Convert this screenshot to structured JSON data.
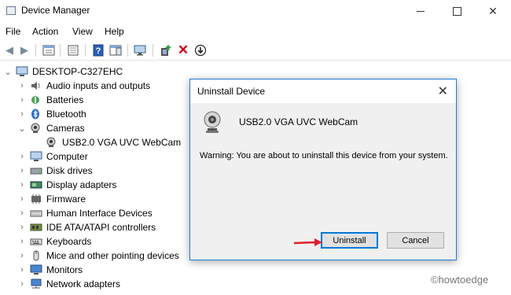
{
  "window": {
    "title": "Device Manager"
  },
  "menu": [
    "File",
    "Action",
    "View",
    "Help"
  ],
  "colors": {
    "accent": "#0078d7",
    "arrow": "#e01f2b",
    "folder": "#3c6fa8"
  },
  "tree": {
    "root": "DESKTOP-C327EHC",
    "items": [
      "Audio inputs and outputs",
      "Batteries",
      "Bluetooth",
      "Cameras",
      "USB2.0 VGA UVC WebCam",
      "Computer",
      "Disk drives",
      "Display adapters",
      "Firmware",
      "Human Interface Devices",
      "IDE ATA/ATAPI controllers",
      "Keyboards",
      "Mice and other pointing devices",
      "Monitors",
      "Network adapters"
    ]
  },
  "dialog": {
    "title": "Uninstall Device",
    "device_name": "USB2.0 VGA UVC WebCam",
    "warning": "Warning: You are about to uninstall this device from your system.",
    "uninstall_label": "Uninstall",
    "cancel_label": "Cancel"
  },
  "watermark": "©howtoedge"
}
